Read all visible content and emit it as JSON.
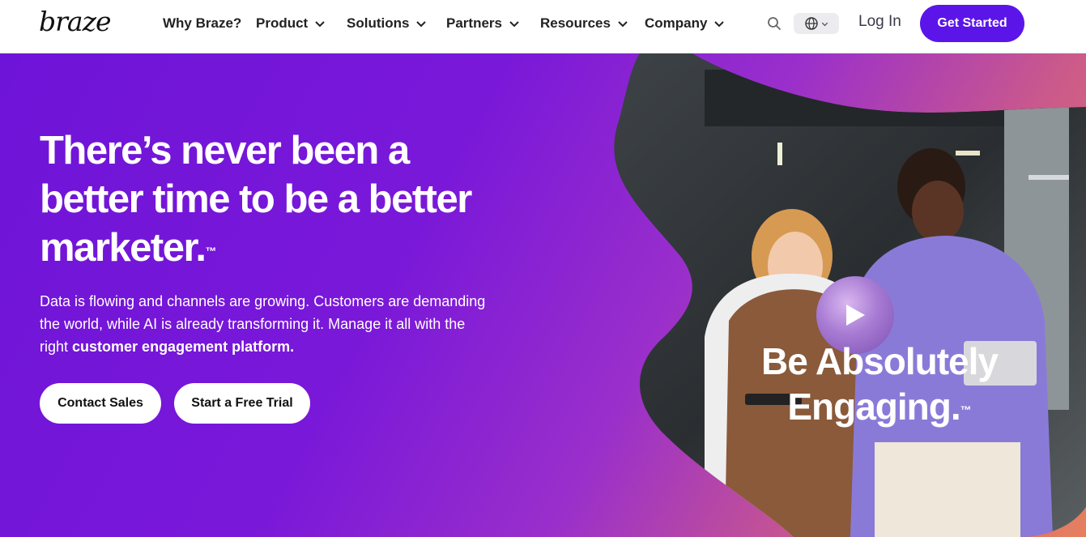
{
  "brand": {
    "logo": "braze"
  },
  "nav": {
    "items": [
      {
        "label": "Why Braze?",
        "has_menu": false
      },
      {
        "label": "Product",
        "has_menu": true
      },
      {
        "label": "Solutions",
        "has_menu": true
      },
      {
        "label": "Partners",
        "has_menu": true
      },
      {
        "label": "Resources",
        "has_menu": true
      },
      {
        "label": "Company",
        "has_menu": true
      }
    ],
    "login": "Log In",
    "cta": "Get Started"
  },
  "hero": {
    "headline": "There’s never been a better time to be a better marketer.",
    "tm": "™",
    "subtext_intro": "Data is flowing and channels are growing. Customers are demanding the world, while AI is already transforming it. Manage it all with the right ",
    "subtext_strong": "customer engagement platform.",
    "buttons": {
      "contact_sales": "Contact Sales",
      "free_trial": "Start a Free Trial"
    },
    "video_overlay": "Be Absolutely Engaging.",
    "video_tm": "™"
  },
  "colors": {
    "accent": "#5b15e8",
    "hero_start": "#6e14d8",
    "hero_end": "#e6805e"
  },
  "icons": [
    "search-icon",
    "globe-icon",
    "chevron-down-icon",
    "play-icon"
  ]
}
